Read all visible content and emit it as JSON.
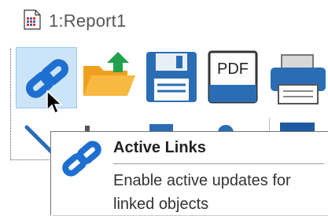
{
  "window": {
    "title": "1:Report1",
    "icon": "report-document-icon"
  },
  "toolbar": {
    "buttons": [
      {
        "name": "active-links",
        "icon": "link-chain-icon",
        "selected": true
      },
      {
        "name": "open",
        "icon": "folder-open-icon"
      },
      {
        "name": "save",
        "icon": "floppy-disk-icon"
      },
      {
        "name": "export-pdf",
        "icon": "pdf-icon",
        "label": "PDF"
      },
      {
        "name": "print",
        "icon": "printer-icon"
      }
    ]
  },
  "tooltip": {
    "title": "Active Links",
    "description": "Enable active updates for linked objects",
    "icon": "link-chain-icon"
  },
  "colors": {
    "selected_bg": "#cce4f7",
    "link_blue": "#1e6fd0",
    "folder_orange": "#f4a928",
    "arrow_green": "#21a14b",
    "floppy_blue": "#2a6db5"
  }
}
